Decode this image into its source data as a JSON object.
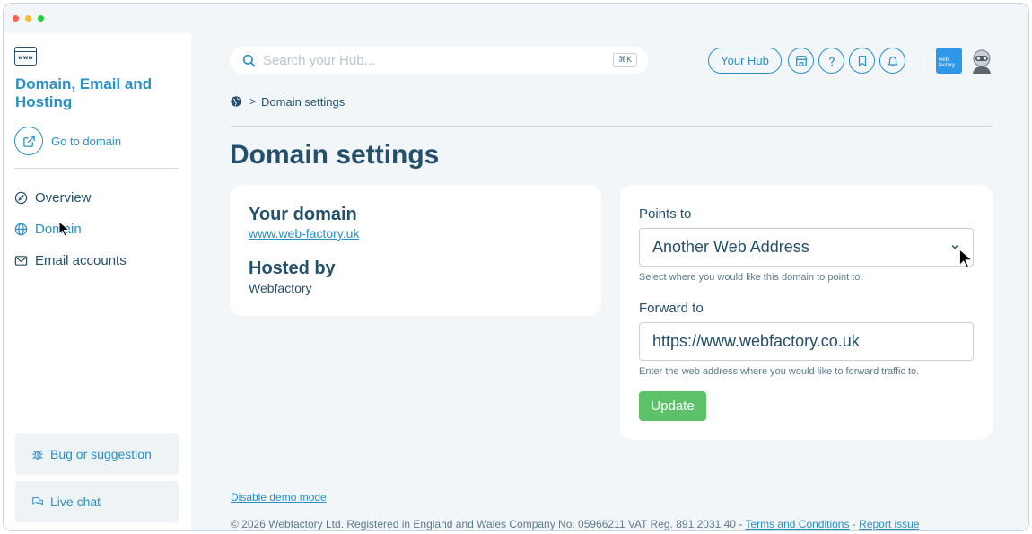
{
  "window": {
    "controls": {
      "close": "#ff5f57",
      "minimize": "#febc2e",
      "maximize": "#28c840"
    }
  },
  "sidebar": {
    "app_icon_text": "www",
    "title": "Domain, Email and Hosting",
    "goto_label": "Go to domain",
    "items": [
      {
        "label": "Overview",
        "icon": "compass-icon"
      },
      {
        "label": "Domain",
        "icon": "globe-icon"
      },
      {
        "label": "Email accounts",
        "icon": "mail-icon"
      }
    ],
    "bug_label": "Bug or suggestion",
    "chat_label": "Live chat"
  },
  "header": {
    "search_placeholder": "Search your Hub...",
    "search_shortcut": "⌘K",
    "hub_label": "Your Hub",
    "logo_text": "web factory",
    "icons": [
      "store-icon",
      "help-icon",
      "bookmark-icon",
      "bell-icon"
    ]
  },
  "breadcrumb": {
    "current": "Domain settings"
  },
  "page": {
    "title": "Domain settings"
  },
  "domain_card": {
    "your_domain_label": "Your domain",
    "domain_link": "www.web-factory.uk",
    "hosted_by_label": "Hosted by",
    "host": "Webfactory"
  },
  "form": {
    "points_to_label": "Points to",
    "points_to_value": "Another Web Address",
    "points_to_help": "Select where you would like this domain to point to.",
    "forward_label": "Forward to",
    "forward_value": "https://www.webfactory.co.uk",
    "forward_help": "Enter the web address where you would like to forward traffic to.",
    "update_label": "Update"
  },
  "footer": {
    "demo_link": "Disable demo mode",
    "copyright": "© 2026 Webfactory Ltd. Registered in England and Wales Company No. 05966211 VAT Reg. 891 2031 40 - ",
    "terms_link": "Terms and Conditions",
    "sep": " - ",
    "report_link": "Report issue"
  },
  "colors": {
    "accent": "#2a8fc4",
    "text": "#24506b",
    "button": "#5cc169",
    "background": "#f2f6f8"
  }
}
